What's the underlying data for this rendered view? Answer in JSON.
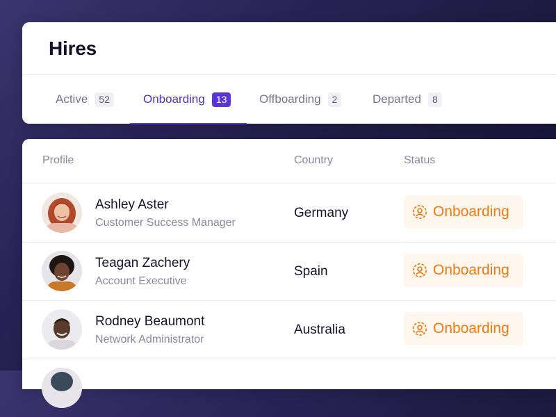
{
  "header": {
    "title": "Hires"
  },
  "tabs": [
    {
      "label": "Active",
      "count": "52",
      "active": false
    },
    {
      "label": "Onboarding",
      "count": "13",
      "active": true
    },
    {
      "label": "Offboarding",
      "count": "2",
      "active": false
    },
    {
      "label": "Departed",
      "count": "8",
      "active": false
    }
  ],
  "table": {
    "columns": {
      "profile": "Profile",
      "country": "Country",
      "status": "Status"
    },
    "rows": [
      {
        "name": "Ashley Aster",
        "role": "Customer Success Manager",
        "country": "Germany",
        "status": "Onboarding"
      },
      {
        "name": "Teagan Zachery",
        "role": "Account Executive",
        "country": "Spain",
        "status": "Onboarding"
      },
      {
        "name": "Rodney Beaumont",
        "role": "Network Administrator",
        "country": "Australia",
        "status": "Onboarding"
      }
    ]
  },
  "colors": {
    "accent": "#5b35d5",
    "status_onboarding_text": "#ec7a12",
    "status_onboarding_bg": "#fff6ed"
  },
  "icons": {
    "status": "user-circle-dashed-icon"
  }
}
